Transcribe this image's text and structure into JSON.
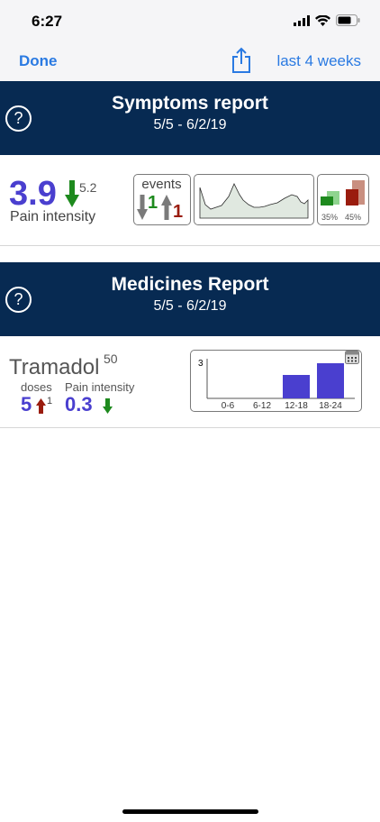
{
  "status": {
    "time": "6:27"
  },
  "nav": {
    "done": "Done",
    "range": "last 4 weeks"
  },
  "symptoms": {
    "title": "Symptoms report",
    "dates": "5/5 - 6/2/19",
    "value": "3.9",
    "previous": "5.2",
    "label": "Pain intensity",
    "events": {
      "title": "events",
      "down": "1",
      "up": "1"
    },
    "bars": {
      "left_pct": "35%",
      "right_pct": "45%"
    }
  },
  "medicines": {
    "title": "Medicines Report",
    "dates": "5/5 - 6/2/19",
    "name": "Tramadol",
    "dose_mg": "50",
    "doses_label": "doses",
    "doses": "5",
    "doses_change": "1",
    "pain_label": "Pain intensity",
    "pain_change": "0.3"
  },
  "chart_data": {
    "type": "bar",
    "categories": [
      "0-6",
      "6-12",
      "12-18",
      "18-24"
    ],
    "values": [
      0,
      0,
      2,
      3
    ],
    "ylim": [
      0,
      3
    ],
    "y_tick_label": "3"
  },
  "colors": {
    "header": "#072a52",
    "accent": "#2a7ae2",
    "value": "#4a3fcf",
    "down": "#1e8a1e",
    "up": "#9a1c0e"
  }
}
